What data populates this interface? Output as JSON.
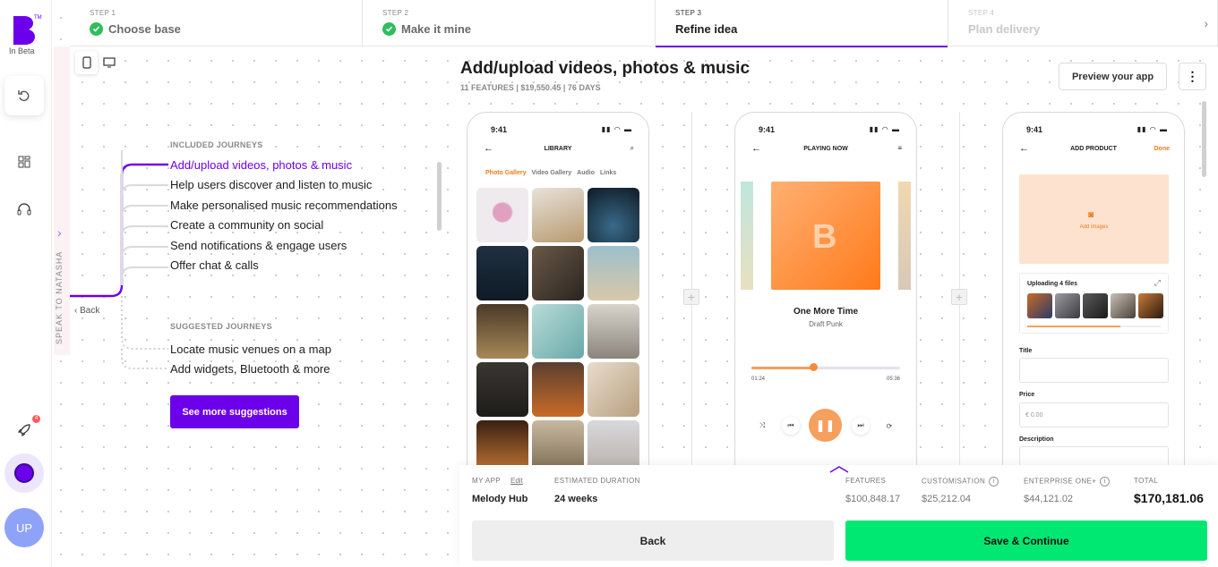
{
  "app": {
    "beta_label": "In Beta"
  },
  "colors": {
    "accent": "#6c00ea",
    "success": "#2fbe5a",
    "cta": "#00e871",
    "orange": "#f5a05a"
  },
  "stepper": {
    "steps": [
      {
        "num": "STEP 1",
        "label": "Choose base",
        "state": "done"
      },
      {
        "num": "STEP 2",
        "label": "Make it mine",
        "state": "done"
      },
      {
        "num": "STEP 3",
        "label": "Refine idea",
        "state": "active"
      },
      {
        "num": "STEP 4",
        "label": "Plan delivery",
        "state": "future"
      }
    ]
  },
  "sidebar": {
    "speak_label": "SPEAK TO NATASHA",
    "back_label": "Back",
    "rocket_badge": "4",
    "avatar_initials": "UP"
  },
  "journeys": {
    "included_title": "INCLUDED JOURNEYS",
    "included": [
      "Add/upload videos, photos & music",
      "Help users discover and listen to music",
      "Make personalised music recommendations",
      "Create a community on social",
      "Send notifications & engage users",
      "Offer chat & calls"
    ],
    "selected_index": 0,
    "suggested_title": "SUGGESTED JOURNEYS",
    "suggested": [
      "Locate music venues on a map",
      "Add widgets, Bluetooth & more"
    ],
    "see_more_label": "See more suggestions"
  },
  "main": {
    "title": "Add/upload videos, photos & music",
    "subtitle": "11 FEATURES | $19,550.45 | 76 DAYS",
    "preview_label": "Preview your app",
    "more_label": "⋮"
  },
  "phones": {
    "time": "9:41",
    "library": {
      "title": "LIBRARY",
      "tabs": [
        "Photo Gallery",
        "Video Gallery",
        "Audio",
        "Links"
      ]
    },
    "player": {
      "title": "PLAYING NOW",
      "song": "One More Time",
      "artist": "Draft Punk",
      "elapsed": "01:24",
      "duration": "05:36",
      "progress": 0.42
    },
    "product": {
      "title": "ADD PRODUCT",
      "done": "Done",
      "add_images": "Add images",
      "uploading": "Uploading 4 files",
      "title_label": "Title",
      "price_label": "Price",
      "price_placeholder": "€ 0.00",
      "description_label": "Description"
    }
  },
  "summary": {
    "my_app_label": "MY APP",
    "edit_label": "Edit",
    "app_name": "Melody Hub",
    "duration_label": "ESTIMATED DURATION",
    "duration": "24 weeks",
    "features_label": "FEATURES",
    "features": "$100,848.17",
    "customisation_label": "CUSTOMISATION",
    "customisation": "$25,212.04",
    "enterprise_label": "ENTERPRISE ONE+",
    "enterprise": "$44,121.02",
    "total_label": "TOTAL",
    "total": "$170,181.06",
    "back_label": "Back",
    "save_label": "Save & Continue"
  }
}
